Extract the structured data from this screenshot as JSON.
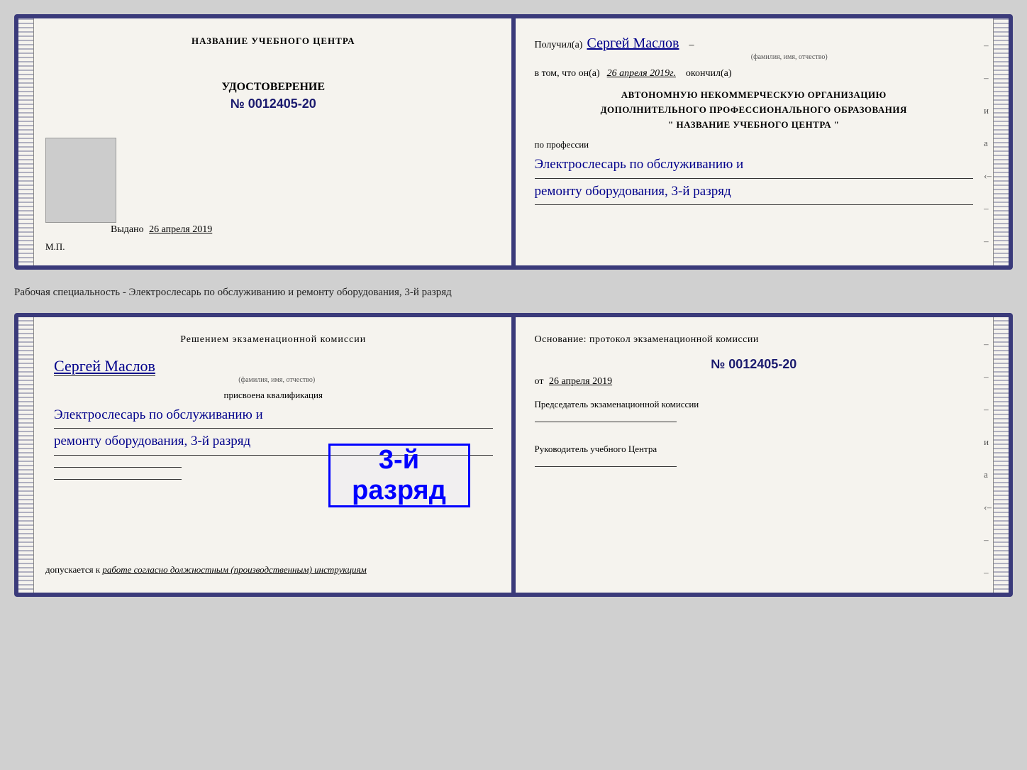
{
  "page": {
    "background_color": "#d0d0d0"
  },
  "top_book": {
    "left": {
      "center_title": "НАЗВАНИЕ УЧЕБНОГО ЦЕНТРА",
      "doc_type": "УДОСТОВЕРЕНИЕ",
      "doc_number": "№ 0012405-20",
      "issued_label": "Выдано",
      "issued_date": "26 апреля 2019",
      "mp_label": "М.П."
    },
    "right": {
      "received_label": "Получил(а)",
      "recipient_name": "Сергей Маслов",
      "recipient_subtitle": "(фамилия, имя, отчество)",
      "dash": "–",
      "vtom_label": "в том, что он(а)",
      "vtom_date": "26 апреля 2019г.",
      "okonchill_label": "окончил(а)",
      "org_line1": "АВТОНОМНУЮ НЕКОММЕРЧЕСКУЮ ОРГАНИЗАЦИЮ",
      "org_line2": "ДОПОЛНИТЕЛЬНОГО ПРОФЕССИОНАЛЬНОГО ОБРАЗОВАНИЯ",
      "org_quote": "\"  НАЗВАНИЕ УЧЕБНОГО ЦЕНТРА  \"",
      "po_professii": "по профессии",
      "profession_line1": "Электрослесарь по обслуживанию и",
      "profession_line2": "ремонту оборудования, 3-й разряд"
    }
  },
  "between": {
    "text": "Рабочая специальность - Электрослесарь по обслуживанию и ремонту оборудования, 3-й разряд"
  },
  "bottom_book": {
    "left": {
      "decision_title": "Решением экзаменационной комиссии",
      "recipient_name": "Сергей Маслов",
      "recipient_subtitle": "(фамилия, имя, отчество)",
      "prisvoena": "присвоена квалификация",
      "qualification_line1": "Электрослесарь по обслуживанию и",
      "qualification_line2": "ремонту оборудования, 3-й разряд",
      "dopuskaetsya_label": "допускается к",
      "dopuskaetsya_value": "работе согласно должностным (производственным) инструкциям"
    },
    "right": {
      "osnovanie_label": "Основание: протокол экзаменационной комиссии",
      "number": "№  0012405-20",
      "ot_label": "от",
      "ot_date": "26 апреля 2019",
      "chair_label": "Председатель экзаменационной комиссии",
      "ruk_label": "Руководитель учебного Центра"
    },
    "stamp": {
      "text": "3-й разряд"
    }
  }
}
